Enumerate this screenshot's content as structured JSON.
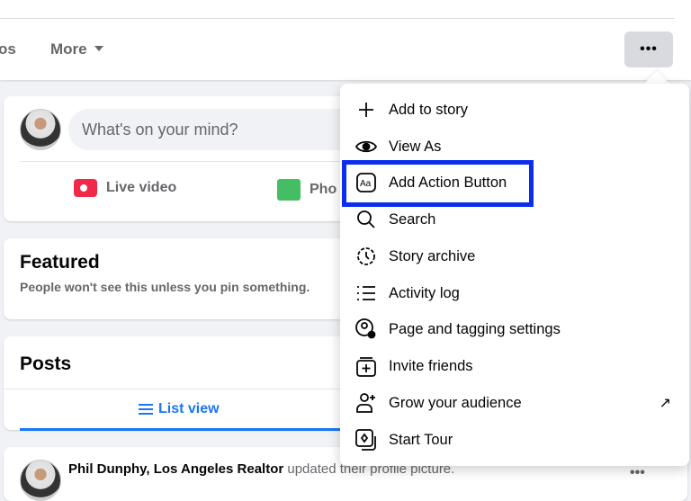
{
  "nav": {
    "partial_tab": "os",
    "more_label": "More",
    "more_options_label": "•••"
  },
  "composer": {
    "placeholder": "What's on your mind?",
    "live_video": "Live video",
    "photo_partial": "Pho"
  },
  "featured": {
    "title": "Featured",
    "subtitle": "People won't see this unless you pin something."
  },
  "posts": {
    "title": "Posts",
    "list_view": "List view"
  },
  "post": {
    "author": "Phil Dunphy, Los Angeles Realtor",
    "action": " updated their profile picture.",
    "menu": "•••"
  },
  "menu": {
    "items": [
      {
        "label": "Add to story",
        "icon": "plus-icon"
      },
      {
        "label": "View As",
        "icon": "eye-icon"
      },
      {
        "label": "Add Action Button",
        "icon": "action-button-icon",
        "highlighted": true
      },
      {
        "label": "Search",
        "icon": "search-icon"
      },
      {
        "label": "Story archive",
        "icon": "clock-icon"
      },
      {
        "label": "Activity log",
        "icon": "list-icon"
      },
      {
        "label": "Page and tagging settings",
        "icon": "user-gear-icon"
      },
      {
        "label": "Invite friends",
        "icon": "invite-icon"
      },
      {
        "label": "Grow your audience",
        "icon": "add-person-icon",
        "external": "↗"
      },
      {
        "label": "Start Tour",
        "icon": "tour-icon"
      }
    ]
  },
  "colors": {
    "accent": "#1877f2",
    "highlight": "#0a2df0"
  }
}
